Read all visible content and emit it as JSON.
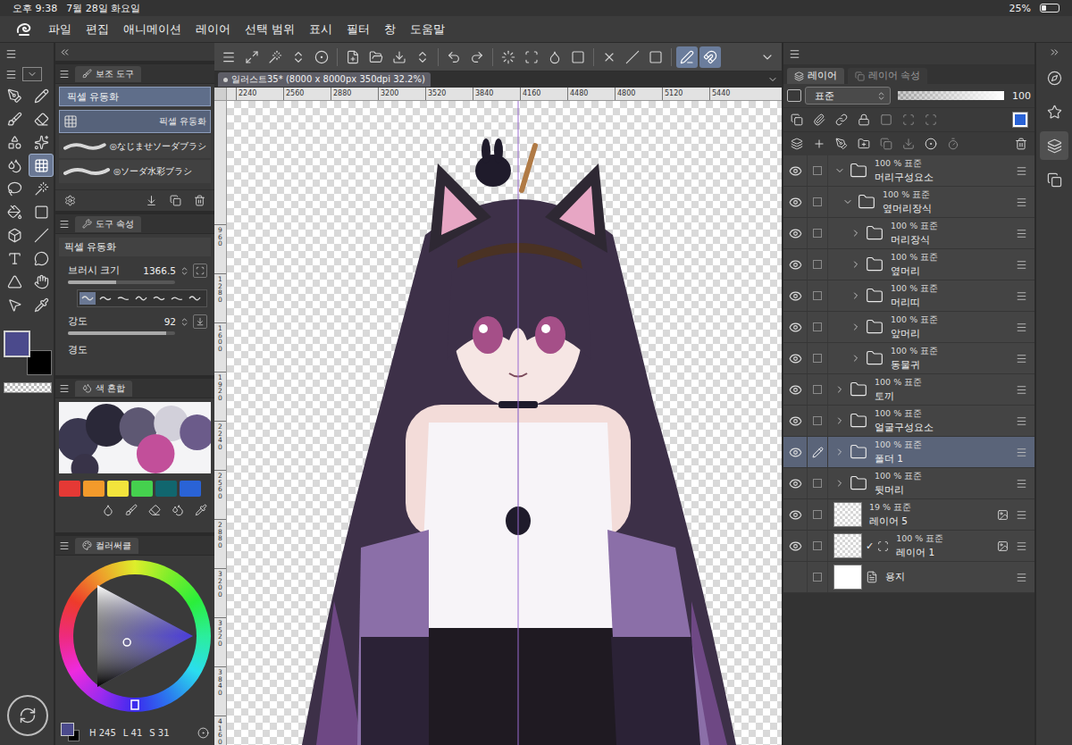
{
  "status_bar": {
    "time": "오후 9:38",
    "date": "7월 28일 화요일",
    "battery": {
      "text": "25%",
      "level": 0.25
    }
  },
  "menu_bar": {
    "items": [
      "파일",
      "편집",
      "애니메이션",
      "레이어",
      "선택 범위",
      "표시",
      "필터",
      "창",
      "도움말"
    ]
  },
  "command_bar": {
    "groups": [
      [
        {
          "selected": false
        },
        {
          "selected": false
        },
        {
          "selected": false
        },
        {
          "selected": false
        },
        {
          "selected": false
        }
      ],
      [
        {
          "selected": false
        },
        {
          "selected": false
        },
        {
          "selected": false
        },
        {
          "selected": false
        }
      ],
      [
        {
          "selected": false
        },
        {
          "selected": false
        }
      ],
      [
        {
          "selected": false
        },
        {
          "selected": false
        },
        {
          "selected": false
        },
        {
          "selected": false
        }
      ],
      [
        {
          "selected": false
        },
        {
          "selected": false
        },
        {
          "selected": false
        }
      ],
      [
        {
          "selected": true
        },
        {
          "selected": true
        }
      ],
      [
        {
          "selected": false
        }
      ]
    ]
  },
  "document_tab": {
    "title": "일러스트35* (8000 x 8000px 350dpi 32.2%)",
    "selected": true
  },
  "rulers": {
    "top": [
      "2240",
      "2560",
      "2880",
      "3200",
      "3520",
      "3840",
      "4160",
      "4480",
      "4800",
      "5120",
      "5440"
    ],
    "left": [
      "960",
      "1280",
      "1600",
      "1920",
      "2240",
      "2560",
      "2880",
      "3200",
      "3520",
      "3840",
      "4160"
    ]
  },
  "tool_palette": {
    "tools": [
      {
        "selected": false
      },
      {
        "selected": false
      },
      {
        "selected": false
      },
      {
        "selected": false
      },
      {
        "selected": false
      },
      {
        "selected": false
      },
      {
        "selected": false
      },
      {
        "selected": true
      },
      {
        "selected": false
      },
      {
        "selected": false
      },
      {
        "selected": false
      },
      {
        "selected": false
      },
      {
        "selected": false
      },
      {
        "selected": false
      },
      {
        "selected": false
      },
      {
        "selected": false
      },
      {
        "selected": false
      },
      {
        "selected": false
      },
      {
        "selected": false
      },
      {
        "selected": false
      }
    ],
    "main_color": "#4b4a8c",
    "sub_color": "#000000"
  },
  "subtool_panel": {
    "tab": "보조 도구",
    "group": "픽셀 유동화",
    "items": [
      {
        "label": "픽셀 유동화",
        "selected": true,
        "kind": "tool"
      },
      {
        "label": "◎なじませソーダブラシ",
        "selected": false,
        "kind": "brush"
      },
      {
        "label": "◎ソーダ水彩ブラシ",
        "selected": false,
        "kind": "brush"
      }
    ]
  },
  "tool_property": {
    "tab": "도구 속성",
    "title": "픽셀 유동화",
    "properties": [
      {
        "label": "브러시 크기",
        "value": "1366.5",
        "level": 0.45,
        "kind": "slider"
      },
      {
        "label": "강도",
        "value": "92",
        "level": 0.92,
        "kind": "slider"
      },
      {
        "label": "경도",
        "kind": "label"
      }
    ],
    "tip_presets": [
      {
        "selected": true
      },
      {
        "selected": false
      },
      {
        "selected": false
      },
      {
        "selected": false
      },
      {
        "selected": false
      },
      {
        "selected": false
      },
      {
        "selected": false
      }
    ]
  },
  "color_mix": {
    "tab": "색 혼합",
    "palette": [
      {
        "color": "#e53935"
      },
      {
        "color": "#f39a2b"
      },
      {
        "color": "#f2e43c"
      },
      {
        "color": "#45d14e"
      },
      {
        "color": "#11666e"
      },
      {
        "color": "#2a63d6"
      }
    ]
  },
  "color_circle": {
    "tab": "컬러써클",
    "main_color": "#4b4a8c",
    "sub_color": "#000000",
    "readout": [
      {
        "label": "H",
        "value": "245"
      },
      {
        "label": "L",
        "value": "41"
      },
      {
        "label": "S",
        "value": "31"
      }
    ]
  },
  "layer_panel": {
    "tabs": [
      {
        "label": "레이어",
        "selected": true
      },
      {
        "label": "레이어 속성",
        "selected": false
      }
    ],
    "blend_mode": "표준",
    "opacity": {
      "value": "100",
      "level": 1
    },
    "layers": [
      {
        "name": "머리구성요소",
        "info": "100 % 표준",
        "kind": "folder",
        "depth": 0,
        "expanded": true,
        "visible": true,
        "selected": false,
        "mark": "",
        "reference": false
      },
      {
        "name": "옆머리장식",
        "info": "100 % 표준",
        "kind": "folder",
        "depth": 1,
        "expanded": true,
        "visible": true,
        "selected": false,
        "mark": "",
        "reference": false
      },
      {
        "name": "머리장식",
        "info": "100 % 표준",
        "kind": "folder",
        "depth": 2,
        "expanded": false,
        "visible": true,
        "selected": false,
        "mark": "",
        "reference": false
      },
      {
        "name": "옆머리",
        "info": "100 % 표준",
        "kind": "folder",
        "depth": 2,
        "expanded": false,
        "visible": true,
        "selected": false,
        "mark": "",
        "reference": false
      },
      {
        "name": "머리띠",
        "info": "100 % 표준",
        "kind": "folder",
        "depth": 2,
        "expanded": false,
        "visible": true,
        "selected": false,
        "mark": "",
        "reference": false
      },
      {
        "name": "앞머리",
        "info": "100 % 표준",
        "kind": "folder",
        "depth": 2,
        "expanded": false,
        "visible": true,
        "selected": false,
        "mark": "",
        "reference": false
      },
      {
        "name": "동물귀",
        "info": "100 % 표준",
        "kind": "folder",
        "depth": 2,
        "expanded": false,
        "visible": true,
        "selected": false,
        "mark": "",
        "reference": false
      },
      {
        "name": "토끼",
        "info": "100 % 표준",
        "kind": "folder",
        "depth": 0,
        "expanded": false,
        "visible": true,
        "selected": false,
        "mark": "",
        "reference": false
      },
      {
        "name": "얼굴구성요소",
        "info": "100 % 표준",
        "kind": "folder",
        "depth": 0,
        "expanded": false,
        "visible": true,
        "selected": false,
        "mark": "",
        "reference": false
      },
      {
        "name": "폴더 1",
        "info": "100 % 표준",
        "kind": "folder",
        "depth": 0,
        "expanded": false,
        "visible": true,
        "selected": true,
        "mark": "",
        "reference": false
      },
      {
        "name": "뒷머리",
        "info": "100 % 표준",
        "kind": "folder",
        "depth": 0,
        "expanded": false,
        "visible": true,
        "selected": false,
        "mark": "",
        "reference": false
      },
      {
        "name": "레이어 5",
        "info": "19 % 표준",
        "kind": "raster",
        "depth": 0,
        "expanded": false,
        "visible": true,
        "selected": false,
        "mark": "",
        "reference": true
      },
      {
        "name": "레이어 1",
        "info": "100 % 표준",
        "kind": "raster",
        "depth": 0,
        "expanded": false,
        "visible": true,
        "selected": false,
        "mark": "✓",
        "reference": true
      },
      {
        "name": "용지",
        "info": "",
        "kind": "paper",
        "depth": 0,
        "expanded": false,
        "visible": false,
        "selected": false,
        "mark": "",
        "reference": false
      }
    ]
  },
  "right_strip": {
    "items": [
      {
        "selected": false
      },
      {
        "selected": false
      },
      {
        "selected": true
      },
      {
        "selected": false
      }
    ]
  }
}
